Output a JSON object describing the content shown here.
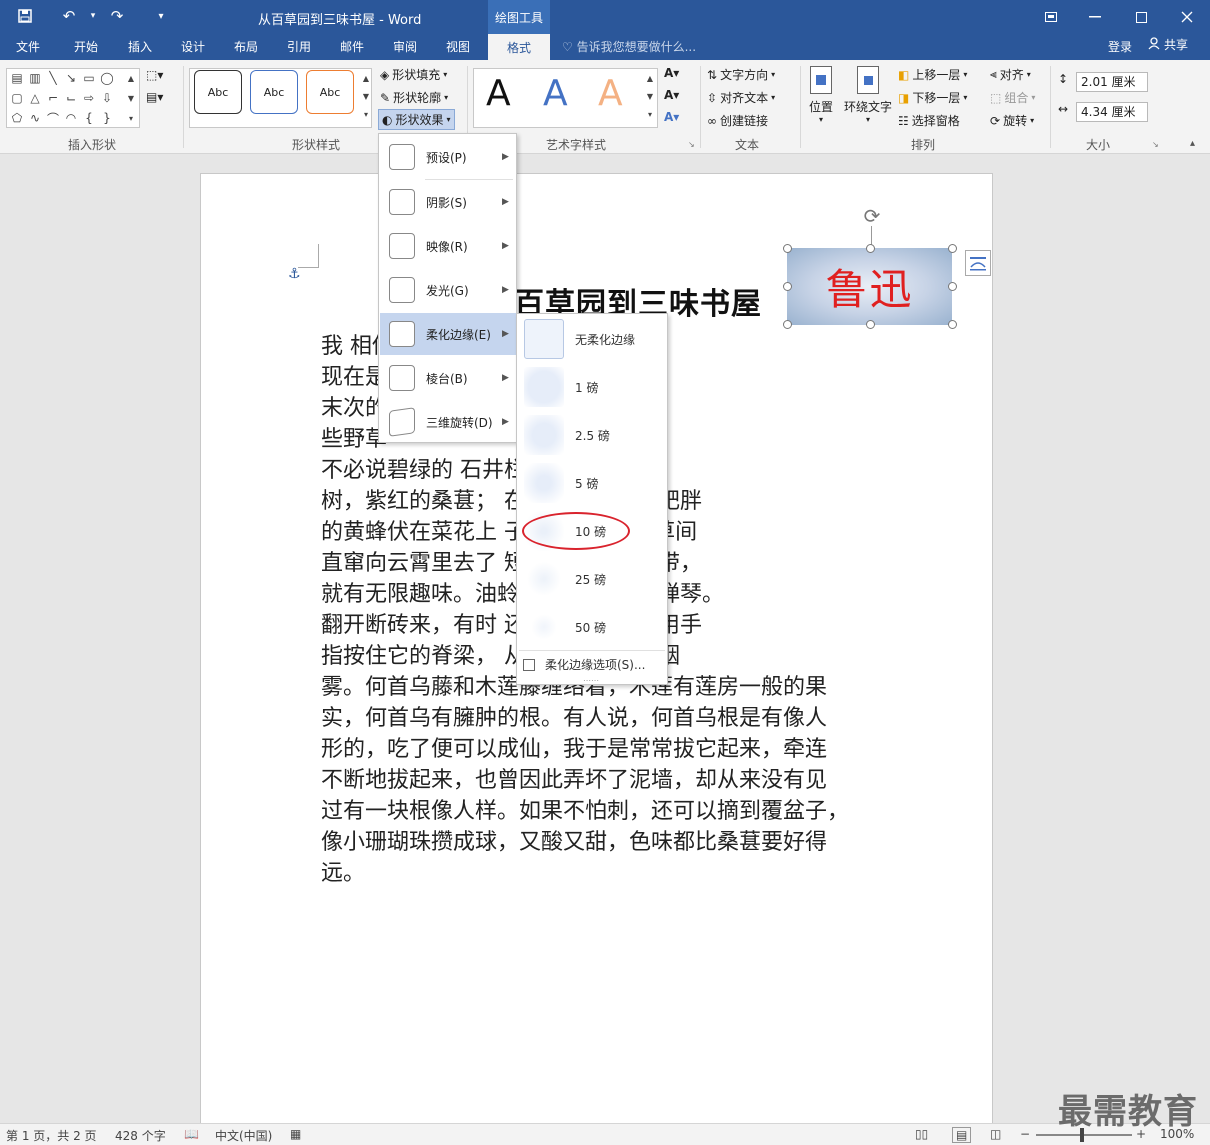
{
  "titlebar": {
    "title": "从百草园到三味书屋 - Word",
    "context_tab": "绘图工具",
    "qa_undo": "↶",
    "qa_redo": "↷"
  },
  "tabs": [
    "文件",
    "开始",
    "插入",
    "设计",
    "布局",
    "引用",
    "邮件",
    "审阅",
    "视图"
  ],
  "active_tab": "格式",
  "tellme": "告诉我您想要做什么...",
  "account": {
    "login": "登录",
    "share": "共享"
  },
  "ribbon": {
    "groups": {
      "insert_shapes": "插入形状",
      "shape_styles": "形状样式",
      "wordart_styles": "艺术字样式",
      "text": "文本",
      "arrange": "排列",
      "size": "大小"
    },
    "style_sample": "Abc",
    "shape_fill": "形状填充",
    "shape_outline": "形状轮廓",
    "shape_effects": "形状效果",
    "wordart_letter": "A",
    "text_direction": "文字方向",
    "align_text": "对齐文本",
    "create_link": "创建链接",
    "position": "位置",
    "wrap_text": "环绕文字",
    "bring_forward": "上移一层",
    "send_backward": "下移一层",
    "selection_pane": "选择窗格",
    "align": "对齐",
    "group": "组合",
    "rotate": "旋转",
    "height": "2.01 厘米",
    "width": "4.34 厘米"
  },
  "effects_menu": [
    {
      "label": "预设(P)"
    },
    {
      "label": "阴影(S)"
    },
    {
      "label": "映像(R)"
    },
    {
      "label": "发光(G)"
    },
    {
      "label": "柔化边缘(E)"
    },
    {
      "label": "棱台(B)"
    },
    {
      "label": "三维旋转(D)"
    }
  ],
  "soft_edges_menu": {
    "items": [
      {
        "label": "无柔化边缘"
      },
      {
        "label": "1 磅"
      },
      {
        "label": "2.5 磅"
      },
      {
        "label": "5 磅"
      },
      {
        "label": "10 磅"
      },
      {
        "label": "25 磅"
      },
      {
        "label": "50 磅"
      }
    ],
    "options": "柔化边缘选项(S)..."
  },
  "document": {
    "heading": "百草园到三味书屋",
    "lines": [
      "我                              相传叫作百草园。",
      "现在是                      公的子孙了，连那最",
      "末次的                      其中似乎确凿只有一",
      "些野草",
      "    不必说碧绿的                石井栏，高大的皂荚",
      "树，紫红的桑葚；                在树叶里长吟，肥胖",
      "的黄蜂伏在菜花上                子(云雀)忽然从草间",
      "直窜向云霄里去了                短短的泥墙根一带，",
      "就有无限趣味。油蛉                蟋蟀们在这里弹琴。",
      "翻开断砖来，有时                还有斑蝥，倘若用手",
      "指按住它的脊梁，                从后窍喷出一阵烟",
      "雾。何首乌藤和木莲藤缠络着，木莲有莲房一般的果",
      "实，何首乌有臃肿的根。有人说，何首乌根是有像人",
      "形的，吃了便可以成仙，我于是常常拔它起来，牵连",
      "不断地拔起来，也曾因此弄坏了泥墙，却从来没有见",
      "过有一块根像人样。如果不怕刺，还可以摘到覆盆子，",
      "像小珊瑚珠攒成球，又酸又甜，色味都比桑葚要好得",
      "远。"
    ],
    "shape_text": "鲁迅"
  },
  "statusbar": {
    "page": "第 1 页，共 2 页",
    "words": "428 个字",
    "language": "中文(中国)",
    "zoom": "100%",
    "zoom_level_percent": 100
  },
  "watermark": "最需教育",
  "colors": {
    "title_bar": "#2b579a",
    "menu_highlight": "#c5d5ee",
    "shape_text": "#e02020",
    "annotation_circle": "#d9232d"
  }
}
